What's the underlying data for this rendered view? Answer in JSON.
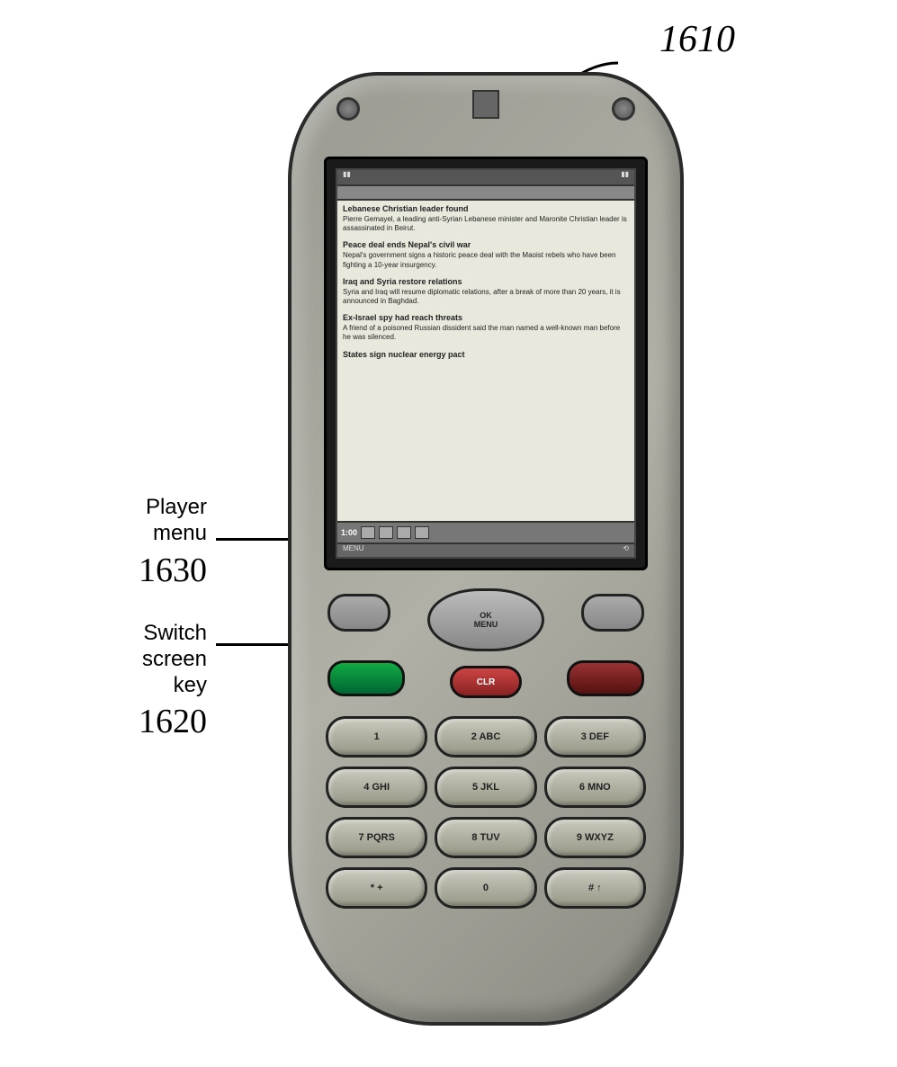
{
  "figure_ref_top": "1610",
  "callouts": {
    "player_menu": {
      "label": "Player\nmenu",
      "ref": "1630"
    },
    "switch_screen": {
      "label": "Switch\nscreen\nkey",
      "ref": "1620"
    }
  },
  "screen": {
    "player_time": "1:00",
    "footer_left": "MENU",
    "news": [
      {
        "headline": "Lebanese Christian leader found",
        "body": "Pierre Gemayel, a leading anti-Syrian Lebanese minister and Maronite Christian leader is assassinated in Beirut."
      },
      {
        "headline": "Peace deal ends Nepal's civil war",
        "body": "Nepal's government signs a historic peace deal with the Maoist rebels who have been fighting a 10-year insurgency."
      },
      {
        "headline": "Iraq and Syria restore relations",
        "body": "Syria and Iraq will resume diplomatic relations, after a break of more than 20 years, it is announced in Baghdad."
      },
      {
        "headline": "Ex-Israel spy had reach threats",
        "body": "A friend of a poisoned Russian dissident said the man named a well-known man before he was silenced."
      },
      {
        "headline": "States sign nuclear energy pact",
        "body": ""
      }
    ]
  },
  "keys": {
    "nav_center": "OK\nMENU",
    "clear": "CLR",
    "digits": [
      "1",
      "2 ABC",
      "3 DEF",
      "4 GHI",
      "5 JKL",
      "6 MNO",
      "7 PQRS",
      "8 TUV",
      "9 WXYZ",
      "* +",
      "0",
      "# ↑"
    ]
  }
}
